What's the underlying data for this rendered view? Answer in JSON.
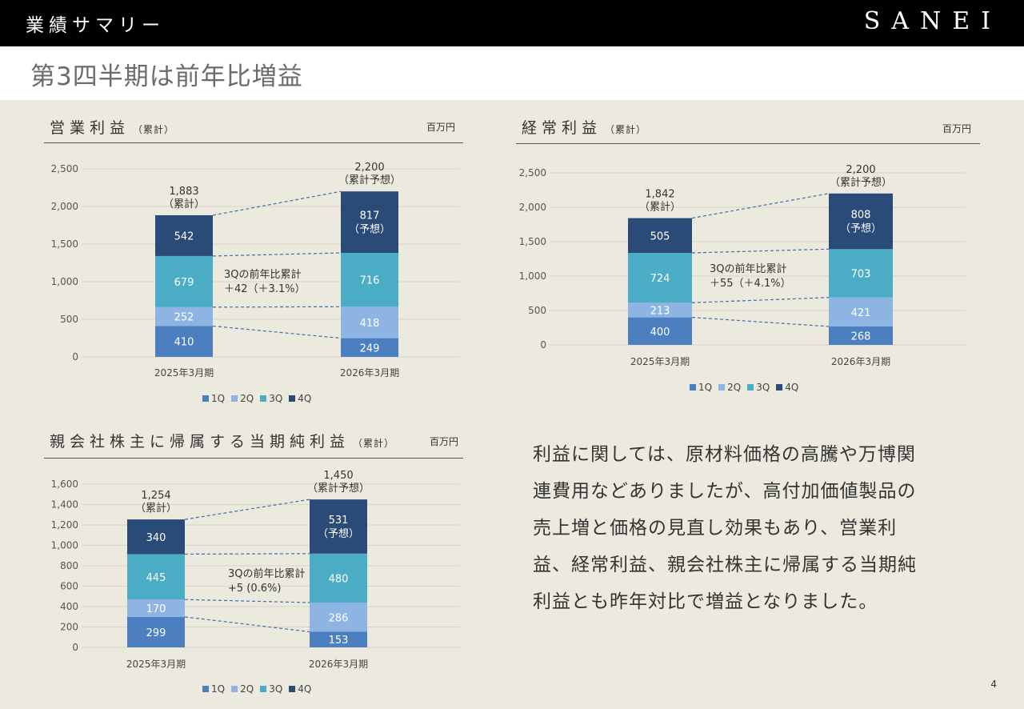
{
  "header": {
    "section_title": "業績サマリー",
    "brand": "SANEI"
  },
  "headline": "第3四半期は前年比増益",
  "colors": {
    "q1": "#4b7fc0",
    "q2": "#8eb4e3",
    "q3": "#4bacc6",
    "q4": "#2a4a78",
    "dash": "#3f6db0"
  },
  "legend": {
    "q1": "1Q",
    "q2": "2Q",
    "q3": "3Q",
    "q4": "4Q"
  },
  "unit_label": "百万円",
  "panels": {
    "operating": {
      "title": "営業利益",
      "subtitle": "（累計）"
    },
    "ordinary": {
      "title": "経常利益",
      "subtitle": "（累計）"
    },
    "net": {
      "title": "親会社株主に帰属する当期純利益",
      "subtitle": "（累計）"
    }
  },
  "commentary": "利益に関しては、原材料価格の高騰や万博関連費用などありましたが、高付加価値製品の売上増と価格の見直し効果もあり、営業利益、経常利益、親会社株主に帰属する当期純利益とも昨年対比で増益となりました。",
  "page_number": "4",
  "chart_data": [
    {
      "id": "operating",
      "type": "bar",
      "stacked": true,
      "categories": [
        "2025年3月期",
        "2026年3月期"
      ],
      "series": [
        {
          "name": "1Q",
          "values": [
            410,
            249
          ]
        },
        {
          "name": "2Q",
          "values": [
            252,
            418
          ]
        },
        {
          "name": "3Q",
          "values": [
            679,
            716
          ]
        },
        {
          "name": "4Q",
          "values": [
            542,
            817
          ]
        }
      ],
      "forecast_label": "（予想）",
      "totals": [
        {
          "value": "1,883",
          "note": "（累計）"
        },
        {
          "value": "2,200",
          "note": "（累計予想）"
        }
      ],
      "annotation": [
        "3Qの前年比累計",
        "＋42（＋3.1%）"
      ],
      "ylim": [
        0,
        2500
      ],
      "yticks": [
        0,
        500,
        1000,
        1500,
        2000,
        2500
      ],
      "ytick_labels": [
        "0",
        "500",
        "1,000",
        "1,500",
        "2,000",
        "2,500"
      ],
      "legend_position": "bottom"
    },
    {
      "id": "ordinary",
      "type": "bar",
      "stacked": true,
      "categories": [
        "2025年3月期",
        "2026年3月期"
      ],
      "series": [
        {
          "name": "1Q",
          "values": [
            400,
            268
          ]
        },
        {
          "name": "2Q",
          "values": [
            213,
            421
          ]
        },
        {
          "name": "3Q",
          "values": [
            724,
            703
          ]
        },
        {
          "name": "4Q",
          "values": [
            505,
            808
          ]
        }
      ],
      "forecast_label": "（予想）",
      "totals": [
        {
          "value": "1,842",
          "note": "（累計）"
        },
        {
          "value": "2,200",
          "note": "（累計予想）"
        }
      ],
      "annotation": [
        "3Qの前年比累計",
        "＋55（＋4.1%）"
      ],
      "ylim": [
        0,
        2500
      ],
      "yticks": [
        0,
        500,
        1000,
        1500,
        2000,
        2500
      ],
      "ytick_labels": [
        "0",
        "500",
        "1,000",
        "1,500",
        "2,000",
        "2,500"
      ],
      "legend_position": "bottom"
    },
    {
      "id": "net",
      "type": "bar",
      "stacked": true,
      "categories": [
        "2025年3月期",
        "2026年3月期"
      ],
      "series": [
        {
          "name": "1Q",
          "values": [
            299,
            153
          ]
        },
        {
          "name": "2Q",
          "values": [
            170,
            286
          ]
        },
        {
          "name": "3Q",
          "values": [
            445,
            480
          ]
        },
        {
          "name": "4Q",
          "values": [
            340,
            531
          ]
        }
      ],
      "forecast_label": "（予想）",
      "totals": [
        {
          "value": "1,254",
          "note": "（累計）"
        },
        {
          "value": "1,450",
          "note": "（累計予想）"
        }
      ],
      "annotation": [
        "3Qの前年比累計",
        "+5 (0.6%)"
      ],
      "ylim": [
        0,
        1600
      ],
      "yticks": [
        0,
        200,
        400,
        600,
        800,
        1000,
        1200,
        1400,
        1600
      ],
      "ytick_labels": [
        "0",
        "200",
        "400",
        "600",
        "800",
        "1,000",
        "1,200",
        "1,400",
        "1,600"
      ],
      "legend_position": "bottom"
    }
  ]
}
